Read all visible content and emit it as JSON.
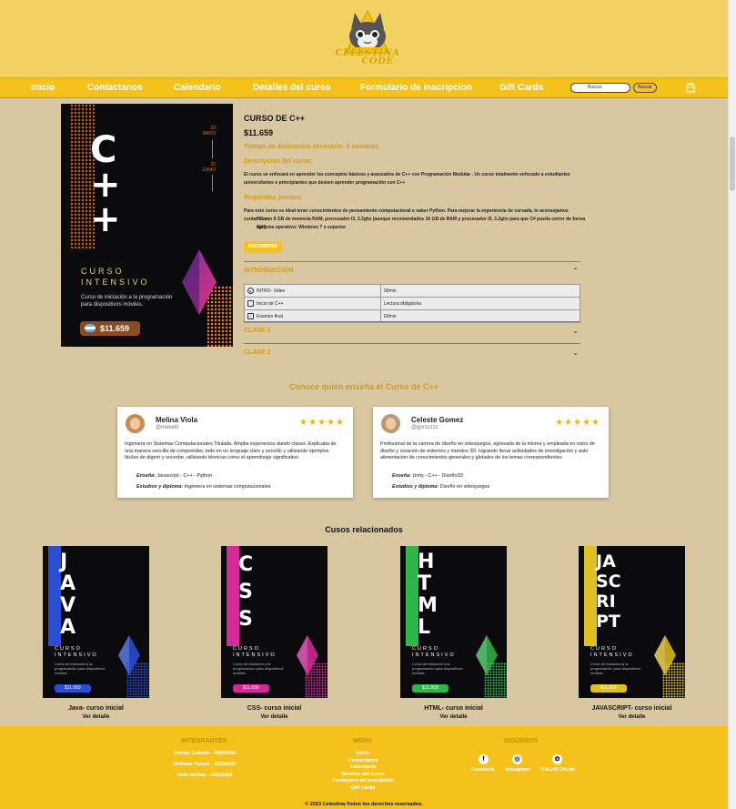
{
  "brand": {
    "name": "CELESTINA CODE",
    "line1": "CELESTINA",
    "line2": "CODE"
  },
  "nav": {
    "items": [
      "Inicio",
      "Contactanos",
      "Calendario",
      "Detalles del curso",
      "Formulario de inscripcion",
      "Gift Cards"
    ],
    "search_placeholder": "Buscar",
    "search_button": "Buscar",
    "cart_icon": "cart-icon"
  },
  "product": {
    "hero": {
      "letters": [
        "C",
        "+",
        "+"
      ],
      "date_start": "22\nMAYO",
      "date_end": "22\nJUNIO",
      "curso": "CURSO\nINTENSIVO",
      "desc": "Curso de iniciación a la programación para dispositivos móviles.",
      "price": "$11.659"
    },
    "title": "CURSO DE C++",
    "price": "$11.659",
    "time": "Tiempo de dedicacion necesario: 4 semanas",
    "desc_heading": "Descripcion del curso:",
    "desc_text": "El curso se enfocará en aprender los conceptos básicos y avanzados de C++ con Programación Modular . Un curso totalmente enfocado a estudiantes universitarios o principiantes que deseen aprender programación con C++",
    "req_heading": "Requisitos previos:",
    "req_text": "Para este curso es ideal tener conocimientos de pensamiento computacional o saber Python. Para mejorar la experiencia de cursada, te aconsejamos contar con:",
    "req_items": [
      "PC con 8 GB de memoria RAM, procesador I3, 2.2ghz (aunque recomendados 16 GB de RAM y procesador I5, 3.2ghz para que C# pueda correr de forma ágil)",
      "Sistema operativo: Windows 7 o superior"
    ],
    "cta": "INSCRIBIRSE",
    "accordion": [
      {
        "label": "INTRODUCCION",
        "open": true
      },
      {
        "label": "CLASE 1",
        "open": false
      },
      {
        "label": "CLASE 2",
        "open": false
      }
    ],
    "intro_rows": [
      {
        "icon": "play-icon",
        "name": "INTRO- Video",
        "detail": "90min"
      },
      {
        "icon": "document-icon",
        "name": "Inicio de C++",
        "detail": "Lectura obligatoria"
      },
      {
        "icon": "check-icon",
        "name": "Examen final",
        "detail": "60min"
      }
    ]
  },
  "instructors": {
    "title": "Conoce quién enseña el Curso de C++",
    "cards": [
      {
        "name": "Melina Viola",
        "handle": "@meeelii",
        "stars": "★★★★★",
        "desc": "Ingeniera en Sistemas Computacionales Titulada. Amplia experiencia dando clases. Explicaba de una manera sencilla de comprender, todo en un lenguaje claro y sencillo y utilizando ejemplos fáciles de digerir y recordar, utilizando técnicas como el aprendizaje significativo.",
        "teaches_label": "Enseña:",
        "teaches": "Javascript - C++ - Python",
        "studies_label": "Estudios y diploma:",
        "studies": "Ingeniera en sistemas computacionales"
      },
      {
        "name": "Celeste Gomez",
        "handle": "@gomzzzc",
        "stars": "★★★★★",
        "desc": "Profesional de la carrera de diseño en videojuegos, egresada de la misma y empleada en rubro de diseño y creación de entornos y mundos 3D. logrando llevar actividades de investigación y auto alimentación de conocimientos generales y globales de los temas correspondientes .",
        "teaches_label": "Enseña:",
        "teaches": "Unity - C++ - Diseño3D",
        "studies_label": "Estudios y diploma:",
        "studies": "Diseño en videojuegos"
      }
    ]
  },
  "related": {
    "title": "Cusos relacionados",
    "items": [
      {
        "word": [
          "J",
          "A",
          "V",
          "A"
        ],
        "name": "Java- curso inicial",
        "link": "Ver detalle",
        "color": "#2a4fd6",
        "price": "$11.659"
      },
      {
        "word": [
          "C",
          "S",
          "S"
        ],
        "name": "CSS- curso inicial",
        "link": "Ver detalle",
        "color": "#d62a9a",
        "price": "$11.659"
      },
      {
        "word": [
          "H",
          "T",
          "M",
          "L"
        ],
        "name": "HTML- curso inicial",
        "link": "Ver detalle",
        "color": "#2eb84a",
        "price": "$11.659"
      },
      {
        "word": [
          "JA",
          "SC",
          "RI",
          "PT"
        ],
        "name": "JAVASCRIPT- curso inicial",
        "link": "Ver detalle",
        "color": "#e0c020",
        "price": "$11.659"
      }
    ],
    "curso": "CURSO\nINTENSIVO",
    "desc": "Curso de iniciación a la programación para dispositivos móviles."
  },
  "footer": {
    "integrantes_title": "INTEGRANTES",
    "integrantes": [
      "Gómez Celeste - 45809998",
      "Shiiman Yanela - 43356937",
      "Viola Melina - 54163024"
    ],
    "menu_title": "MENU",
    "menu": [
      "Inicio",
      "Contactanos",
      "Calendario",
      "Detalles del curso",
      "Formulario de inscripcion",
      "Gift Cards"
    ],
    "social_title": "SIGUENOS",
    "social": [
      {
        "label": "Facebook",
        "icon": "facebook-icon",
        "glyph": "f"
      },
      {
        "label": "Instagram",
        "icon": "instagram-icon",
        "glyph": "◎"
      },
      {
        "label": "UNLaM Oficial",
        "icon": "unlam-icon",
        "glyph": "✿"
      }
    ],
    "copyright": "© 2023 Celestina-Todos los derechos reservados."
  },
  "colors": {
    "accent": "#f4c21b",
    "header": "#f3d262",
    "page": "#d9c7a1",
    "heading": "#d49a1a"
  }
}
